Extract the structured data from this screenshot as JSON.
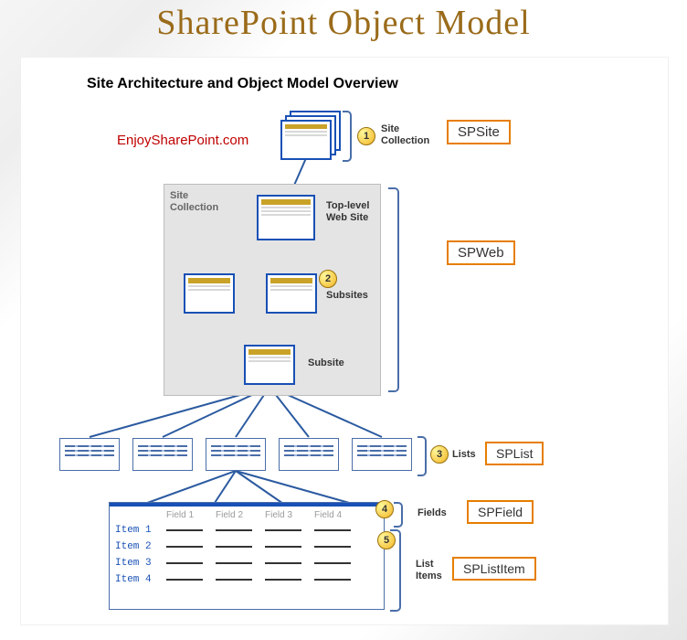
{
  "title": "SharePoint Object Model",
  "subtitle": "Site Architecture and Object Model Overview",
  "watermark": "EnjoySharePoint.com",
  "groupbox_title": "Site\nCollection",
  "badges": {
    "b1": "1",
    "b2": "2",
    "b3": "3",
    "b4": "4",
    "b5": "5"
  },
  "labels": {
    "site_collection": "Site\nCollection",
    "top_level": "Top-level\nWeb Site",
    "subsites": "Subsites",
    "subsite": "Subsite",
    "lists": "Lists",
    "fields": "Fields",
    "list_items": "List\nItems"
  },
  "classes": {
    "spsite": "SPSite",
    "spweb": "SPWeb",
    "splist": "SPList",
    "spfield": "SPField",
    "splistitem": "SPListItem"
  },
  "table": {
    "fields": [
      "Field 1",
      "Field 2",
      "Field 3",
      "Field 4"
    ],
    "items": [
      "Item 1",
      "Item 2",
      "Item 3",
      "Item 4"
    ]
  }
}
